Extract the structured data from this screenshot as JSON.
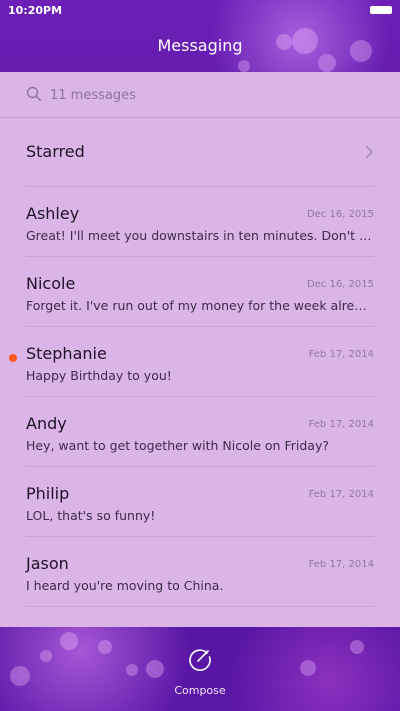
{
  "status_bar": {
    "time": "10:20PM"
  },
  "header": {
    "title": "Messaging"
  },
  "search": {
    "placeholder": "11 messages"
  },
  "starred": {
    "label": "Starred"
  },
  "conversations": [
    {
      "name": "Ashley",
      "date": "Dec 16, 2015",
      "preview": "Great! I'll meet you downstairs in ten minutes. Don't forget to bring the tickets.",
      "unread": false
    },
    {
      "name": "Nicole",
      "date": "Dec 16, 2015",
      "preview": "Forget it. I've run out of my money for the week already.",
      "unread": false
    },
    {
      "name": "Stephanie",
      "date": "Feb 17, 2014",
      "preview": "Happy Birthday to you!",
      "unread": true
    },
    {
      "name": "Andy",
      "date": "Feb 17, 2014",
      "preview": "Hey, want to get together with Nicole on Friday?",
      "unread": false
    },
    {
      "name": "Philip",
      "date": "Feb 17, 2014",
      "preview": "LOL, that's so funny!",
      "unread": false
    },
    {
      "name": "Jason",
      "date": "Feb 17, 2014",
      "preview": "I heard you're moving to China.",
      "unread": false
    }
  ],
  "footer": {
    "compose_label": "Compose"
  },
  "icons": {
    "search": "search-icon",
    "chevron": "chevron-right-icon",
    "compose": "compose-icon"
  },
  "colors": {
    "unread_dot": "#ff5a1c",
    "panel": "#dcb5e8",
    "accent": "#6d1fb8"
  }
}
